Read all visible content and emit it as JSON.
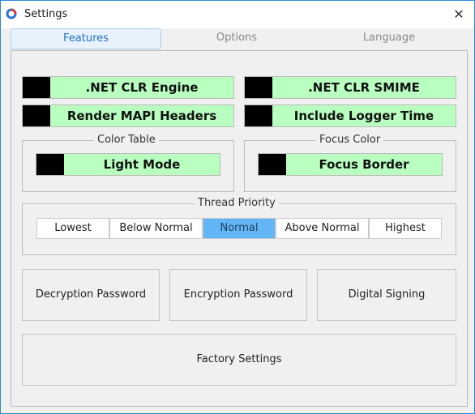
{
  "window": {
    "title": "Settings"
  },
  "tabs": [
    "Features",
    "Options",
    "Language"
  ],
  "features": {
    "net_clr_engine": ".NET CLR Engine",
    "net_clr_smime": ".NET CLR SMIME",
    "render_mapi_headers": "Render MAPI Headers",
    "include_logger_time": "Include Logger Time"
  },
  "color_table": {
    "legend": "Color Table",
    "value": "Light Mode"
  },
  "focus_color": {
    "legend": "Focus Color",
    "value": "Focus Border"
  },
  "thread_priority": {
    "legend": "Thread Priority",
    "options": [
      "Lowest",
      "Below Normal",
      "Normal",
      "Above Normal",
      "Highest"
    ],
    "selected": "Normal"
  },
  "actions": {
    "decryption_password": "Decryption Password",
    "encryption_password": "Encryption Password",
    "digital_signing": "Digital Signing",
    "factory_settings": "Factory Settings"
  },
  "colors": {
    "accent_blue": "#63b6f5",
    "feature_green": "#b8ffc0",
    "swatch_black": "#000000",
    "window_border": "#2b8ad6"
  },
  "icons": {
    "app": "app-ring-icon",
    "close": "close-icon"
  }
}
